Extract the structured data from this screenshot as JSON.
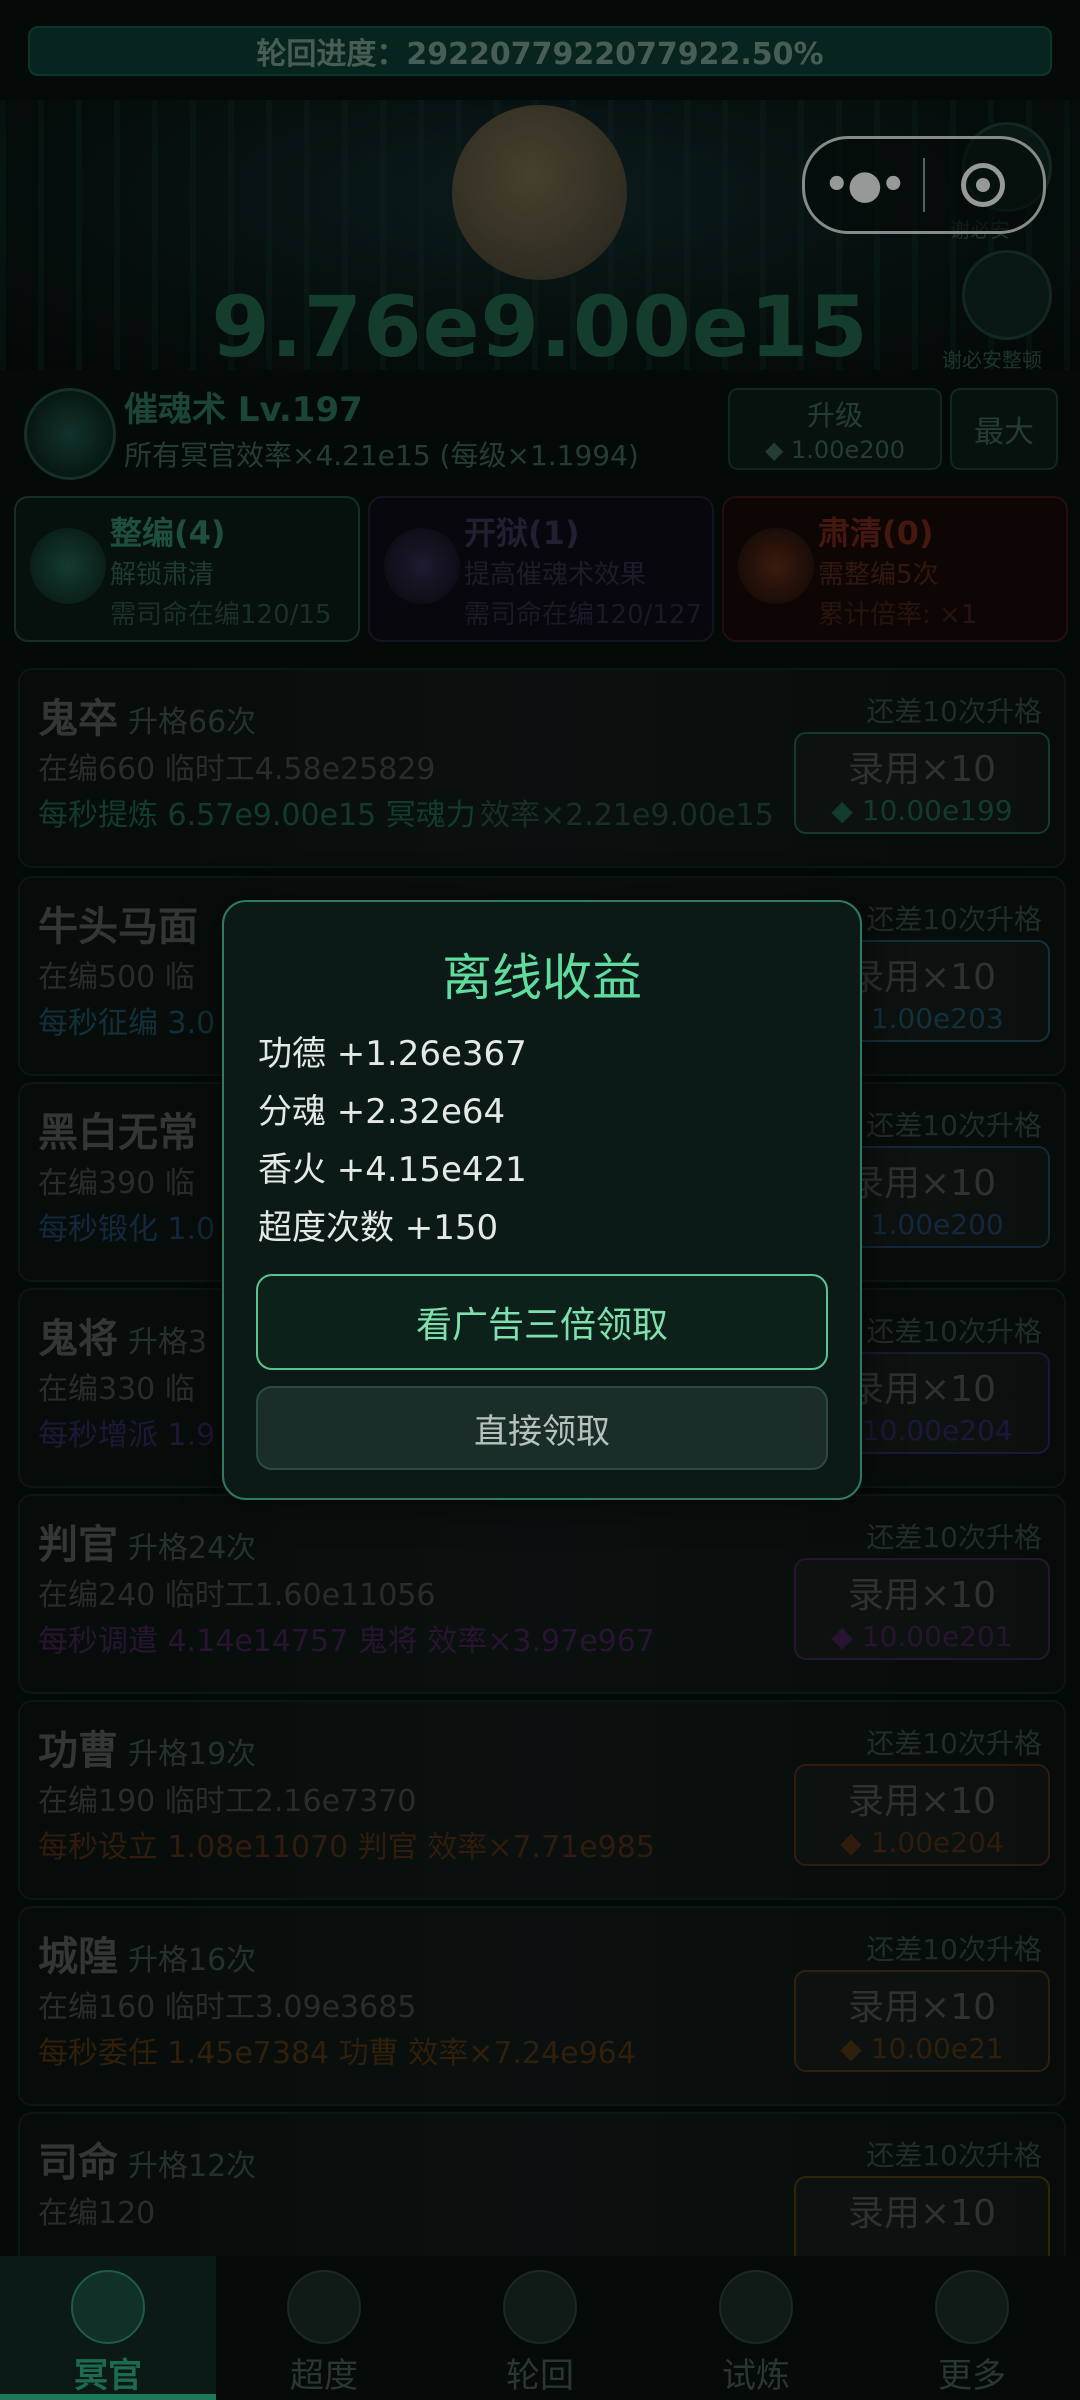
{
  "progress": {
    "text": "轮回进度：2922077922077922.50%"
  },
  "hero": {
    "big_value": "9.76e9.00e15",
    "side_label_1": "谢必安",
    "side_label_2": "谢必安整顿"
  },
  "capsule": {
    "menu_icon": "more-dots-icon",
    "close_icon": "target-circle-icon"
  },
  "skill": {
    "name": "催魂术 Lv.197",
    "desc": "所有冥官效率×4.21e15 (每级×1.1994)",
    "upgrade_label": "升级",
    "upgrade_cost": "◆ 1.00e200",
    "max_label": "最大"
  },
  "cards": [
    {
      "title": "整编(4)",
      "desc": "解锁肃清",
      "req": "需司命在编120/15",
      "color": "#2b8a66"
    },
    {
      "title": "开狱(1)",
      "desc": "提高催魂术效果",
      "req": "需司命在编120/127",
      "color": "#3e3c5a"
    },
    {
      "title": "肃清(0)",
      "desc": "需整编5次",
      "req": "累计倍率: ×1",
      "color": "#7a2a1c"
    }
  ],
  "rows": [
    {
      "name": "鬼卒",
      "level": "升格66次",
      "line2": "在编660  临时工4.58e25829",
      "line3": "每秒提炼 6.57e9.00e15 冥魂力",
      "extra": "效率×2.21e9.00e15",
      "remain": "还差10次升格",
      "btn": "录用×10",
      "cost": "◆ 10.00e199",
      "accent": "#1e5a47"
    },
    {
      "name": "牛头马面",
      "level": "",
      "line2": "在编500  临",
      "line3": "每秒征编 3.0",
      "extra": "",
      "remain": "还差10次升格",
      "btn": "录用×10",
      "cost": "◆ 1.00e203",
      "accent": "#1e4a5a"
    },
    {
      "name": "黑白无常",
      "level": "",
      "line2": "在编390  临",
      "line3": "每秒锻化 1.0",
      "extra": "",
      "remain": "还差10次升格",
      "btn": "录用×10",
      "cost": "◆ 1.00e200",
      "accent": "#1e3d5e"
    },
    {
      "name": "鬼将",
      "level": "升格3",
      "line2": "在编330  临",
      "line3": "每秒增派 1.9",
      "extra": "",
      "remain": "还差10次升格",
      "btn": "录用×10",
      "cost": "◆ 10.00e204",
      "accent": "#2e2358"
    },
    {
      "name": "判官",
      "level": "升格24次",
      "line2": "在编240  临时工1.60e11056",
      "line3": "每秒调遣 4.14e14757 鬼将  效率×3.97e967",
      "extra": "",
      "remain": "还差10次升格",
      "btn": "录用×10",
      "cost": "◆ 10.00e201",
      "accent": "#3e1f4a"
    },
    {
      "name": "功曹",
      "level": "升格19次",
      "line2": "在编190  临时工2.16e7370",
      "line3": "每秒设立 1.08e11070 判官  效率×7.71e985",
      "extra": "",
      "remain": "还差10次升格",
      "btn": "录用×10",
      "cost": "◆ 1.00e204",
      "accent": "#4a2a14"
    },
    {
      "name": "城隍",
      "level": "升格16次",
      "line2": "在编160  临时工3.09e3685",
      "line3": "每秒委任 1.45e7384 功曹  效率×7.24e964",
      "extra": "",
      "remain": "还差10次升格",
      "btn": "录用×10",
      "cost": "◆ 10.00e21",
      "accent": "#4a3010"
    },
    {
      "name": "司命",
      "level": "升格12次",
      "line2": "在编120",
      "line3": "",
      "extra": "",
      "remain": "还差10次升格",
      "btn": "录用×10",
      "cost": "",
      "accent": "#4a3a10"
    }
  ],
  "modal": {
    "title": "离线收益",
    "items": [
      "功德 +1.26e367",
      "分魂 +2.32e64",
      "香火 +4.15e421",
      "超度次数 +150"
    ],
    "btn_triple": "看广告三倍领取",
    "btn_direct": "直接领取"
  },
  "nav": [
    {
      "label": "冥官",
      "icon": "ghost-official-icon",
      "active": true
    },
    {
      "label": "超度",
      "icon": "lantern-icon",
      "active": false
    },
    {
      "label": "轮回",
      "icon": "wheel-icon",
      "active": false
    },
    {
      "label": "试炼",
      "icon": "trial-icon",
      "active": false
    },
    {
      "label": "更多",
      "icon": "more-icon",
      "active": false
    }
  ]
}
